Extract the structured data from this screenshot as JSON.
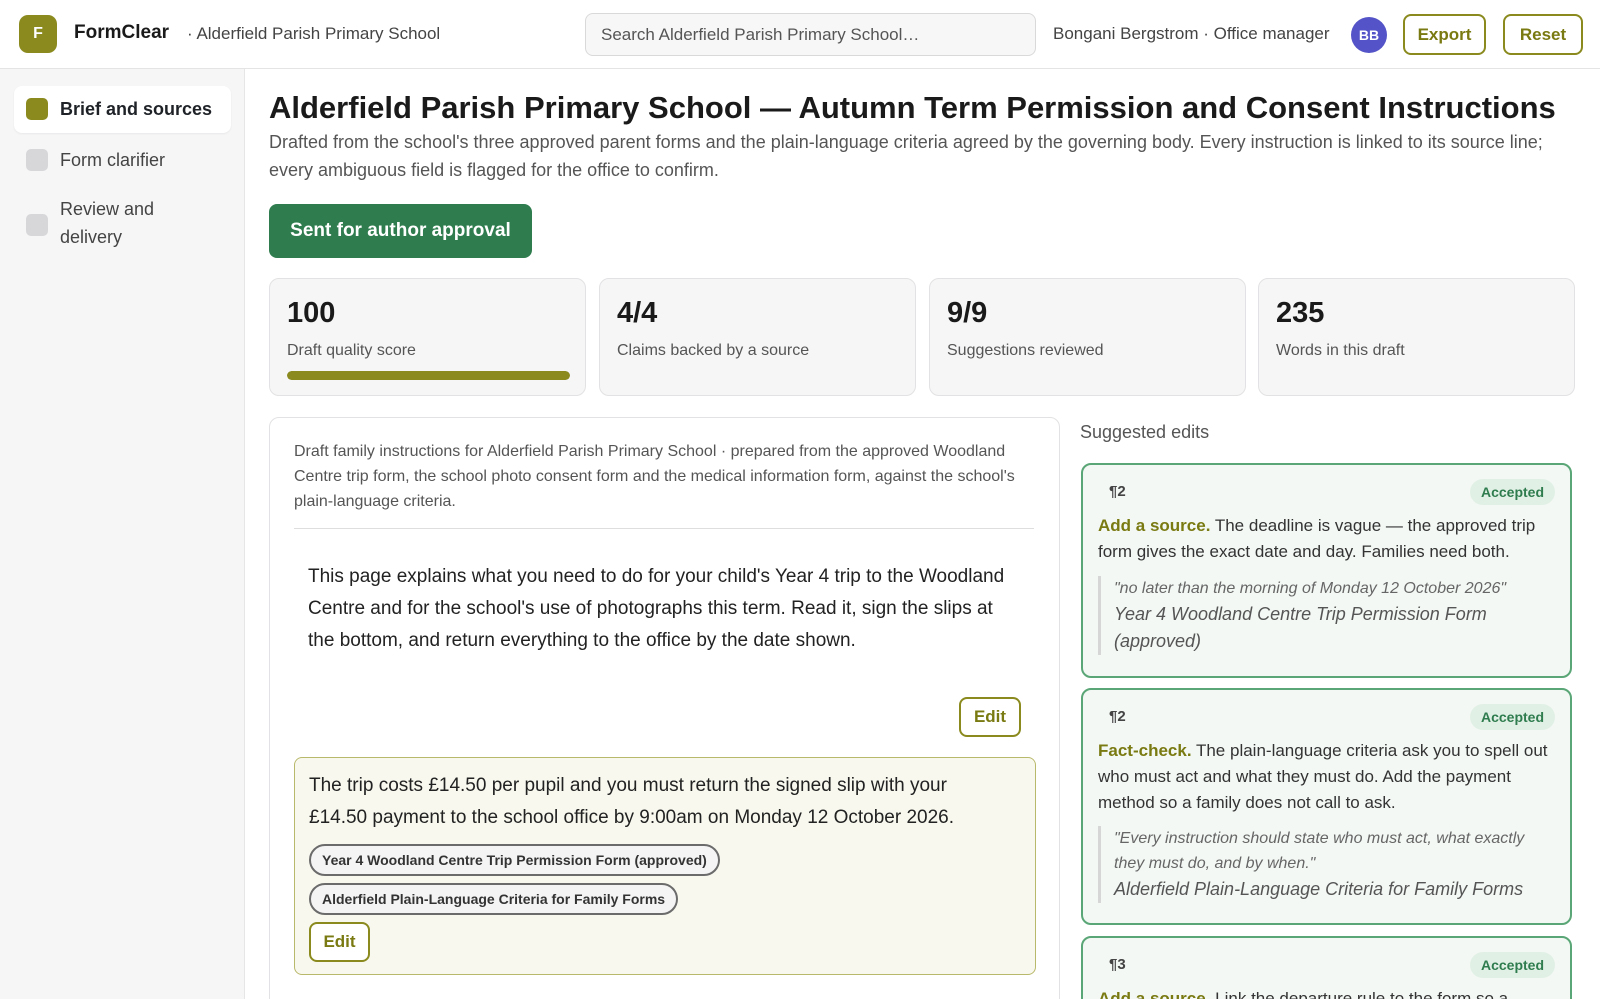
{
  "header": {
    "logo_letter": "F",
    "app_name": "FormClear",
    "school": "· Alderfield Parish Primary School",
    "search_placeholder": "Search Alderfield Parish Primary School…",
    "user": "Bongani Bergstrom · Office manager",
    "avatar_initials": "BB",
    "export_label": "Export",
    "reset_label": "Reset"
  },
  "sidebar": {
    "items": [
      {
        "label": "Brief and sources",
        "active": true
      },
      {
        "label": "Form clarifier",
        "active": false
      },
      {
        "label": "Review and delivery",
        "active": false
      }
    ]
  },
  "main": {
    "title": "Alderfield Parish Primary School — Autumn Term Permission and Consent Instructions",
    "subtitle": "Drafted from the school's three approved parent forms and the plain-language criteria agreed by the governing body. Every instruction is linked to its source line; every ambiguous field is flagged for the office to confirm.",
    "status_label": "Sent for author approval",
    "stats": [
      {
        "value": "100",
        "label": "Draft quality score",
        "progress": 1.0
      },
      {
        "value": "4/4",
        "label": "Claims backed by a source"
      },
      {
        "value": "9/9",
        "label": "Suggestions reviewed"
      },
      {
        "value": "235",
        "label": "Words in this draft"
      }
    ],
    "draft": {
      "intro": "Draft family instructions for Alderfield Parish Primary School · prepared from the approved Woodland Centre trip form, the school photo consent form and the medical information form, against the school's plain-language criteria.",
      "paragraphs": [
        {
          "text": "This page explains what you need to do for your child's Year 4 trip to the Woodland Centre and for the school's use of photographs this term. Read it, sign the slips at the bottom, and return everything to the office by the date shown.",
          "edit_label": "Edit"
        },
        {
          "text": "The trip costs £14.50 per pupil and you must return the signed slip with your £14.50 payment to the school office by 9:00am on Monday 12 October 2026.",
          "sources": [
            "Year 4 Woodland Centre Trip Permission Form (approved)",
            "Alderfield Plain-Language Criteria for Family Forms"
          ],
          "edit_label": "Edit"
        }
      ]
    }
  },
  "suggestions": {
    "heading": "Suggested edits",
    "items": [
      {
        "para": "¶2",
        "status": "Accepted",
        "kind": "Add a source.",
        "text": "The deadline is vague — the approved trip form gives the exact date and day. Families need both.",
        "quote": "\"no later than the morning of Monday 12 October 2026\"",
        "source": "Year 4 Woodland Centre Trip Permission Form (approved)"
      },
      {
        "para": "¶2",
        "status": "Accepted",
        "kind": "Fact-check.",
        "text": "The plain-language criteria ask you to spell out who must act and what they must do. Add the payment method so a family does not call to ask.",
        "quote": "\"Every instruction should state who must act, what exactly they must do, and by when.\"",
        "source": "Alderfield Plain-Language Criteria for Family Forms"
      },
      {
        "para": "¶3",
        "status": "Accepted",
        "kind": "Add a source.",
        "text": "Link the departure rule to the form so a"
      }
    ]
  },
  "colors": {
    "accent": "#8a8a1f",
    "success": "#2f7d4f",
    "avatar": "#5454c8"
  }
}
